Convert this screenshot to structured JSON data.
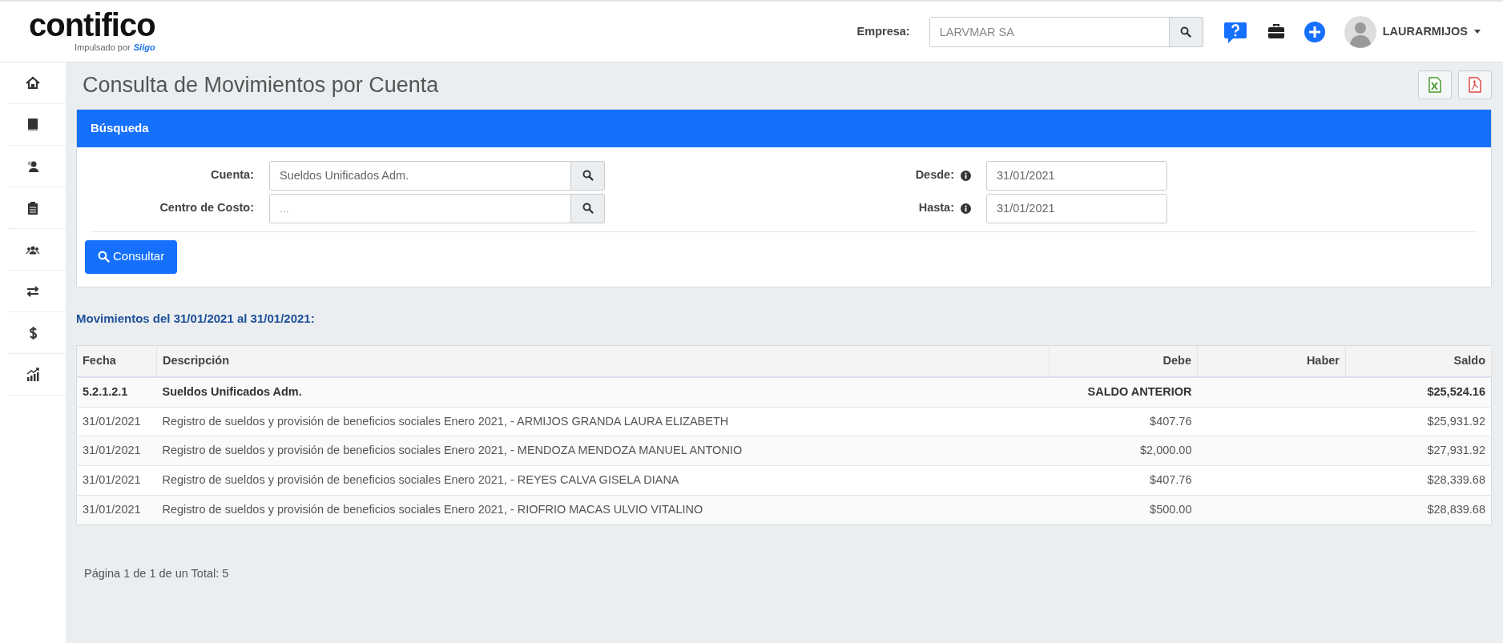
{
  "header": {
    "logo": "contifico",
    "tagline": "Impulsado por",
    "tagline_brand": "Siigo",
    "empresa_label": "Empresa:",
    "empresa_value": "LARVMAR SA",
    "user": "LAURARMIJOS"
  },
  "page_title": "Consulta de Movimientos por Cuenta",
  "search_panel": {
    "title": "Búsqueda",
    "fields": [
      {
        "label": "Cuenta:",
        "value": "Sueldos Unificados Adm."
      },
      {
        "label": "Centro de Costo:",
        "placeholder": "..."
      }
    ],
    "dates": [
      {
        "label": "Desde:",
        "value": "31/01/2021"
      },
      {
        "label": "Hasta:",
        "value": "31/01/2021"
      }
    ],
    "button": "Consultar"
  },
  "results_title": "Movimientos del 31/01/2021 al 31/01/2021:",
  "table": {
    "columns": [
      "Fecha",
      "Descripción",
      "Debe",
      "Haber",
      "Saldo"
    ],
    "rows": [
      {
        "kind": "account",
        "fecha": "5.2.1.2.1",
        "descripcion": "Sueldos Unificados Adm.",
        "debe": "SALDO ANTERIOR",
        "saldo": "$25,524.16"
      },
      {
        "kind": "entry",
        "fecha": "31/01/2021",
        "descripcion": "Registro de sueldos y provisión de beneficios sociales Enero 2021, - ARMIJOS GRANDA LAURA ELIZABETH",
        "debe": "$407.76",
        "saldo": "$25,931.92"
      },
      {
        "kind": "entry",
        "fecha": "31/01/2021",
        "descripcion": "Registro de sueldos y provisión de beneficios sociales Enero 2021, - MENDOZA MENDOZA MANUEL ANTONIO",
        "debe": "$2,000.00",
        "saldo": "$27,931.92"
      },
      {
        "kind": "entry",
        "fecha": "31/01/2021",
        "descripcion": "Registro de sueldos y provisión de beneficios sociales Enero 2021, - REYES CALVA GISELA DIANA",
        "debe": "$407.76",
        "saldo": "$28,339.68"
      },
      {
        "kind": "entry",
        "fecha": "31/01/2021",
        "descripcion": "Registro de sueldos y provisión de beneficios sociales Enero 2021, - RIOFRIO MACAS ULVIO VITALINO",
        "debe": "$500.00",
        "saldo": "$28,839.68"
      }
    ]
  },
  "pagination": "Página 1 de 1 de un Total: 5"
}
